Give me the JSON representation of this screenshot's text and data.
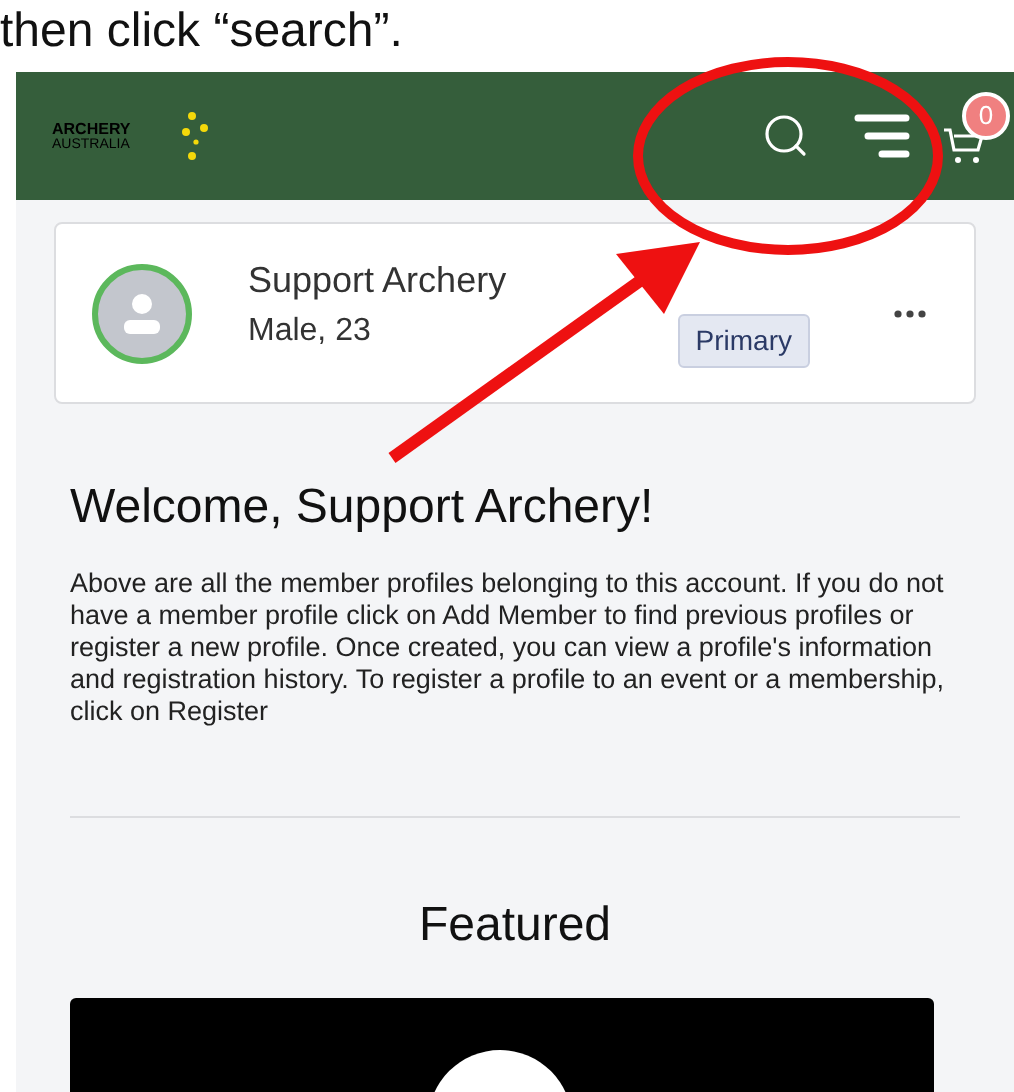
{
  "caption": "then click “search”.",
  "header": {
    "logo_text": [
      "ARCHERY",
      "AUSTRALIA"
    ],
    "cart_count": "0"
  },
  "profile": {
    "name": "Support Archery",
    "details": "Male, 23",
    "badge": "Primary"
  },
  "welcome": {
    "title": "Welcome, Support Archery!",
    "body": "Above are all the member profiles belonging to this account. If you do not have a member profile click on Add Member to find previous profiles or register a new profile. Once created, you can view a profile's information and registration history. To register a profile to an event or a membership, click on Register"
  },
  "featured": {
    "title": "Featured"
  }
}
